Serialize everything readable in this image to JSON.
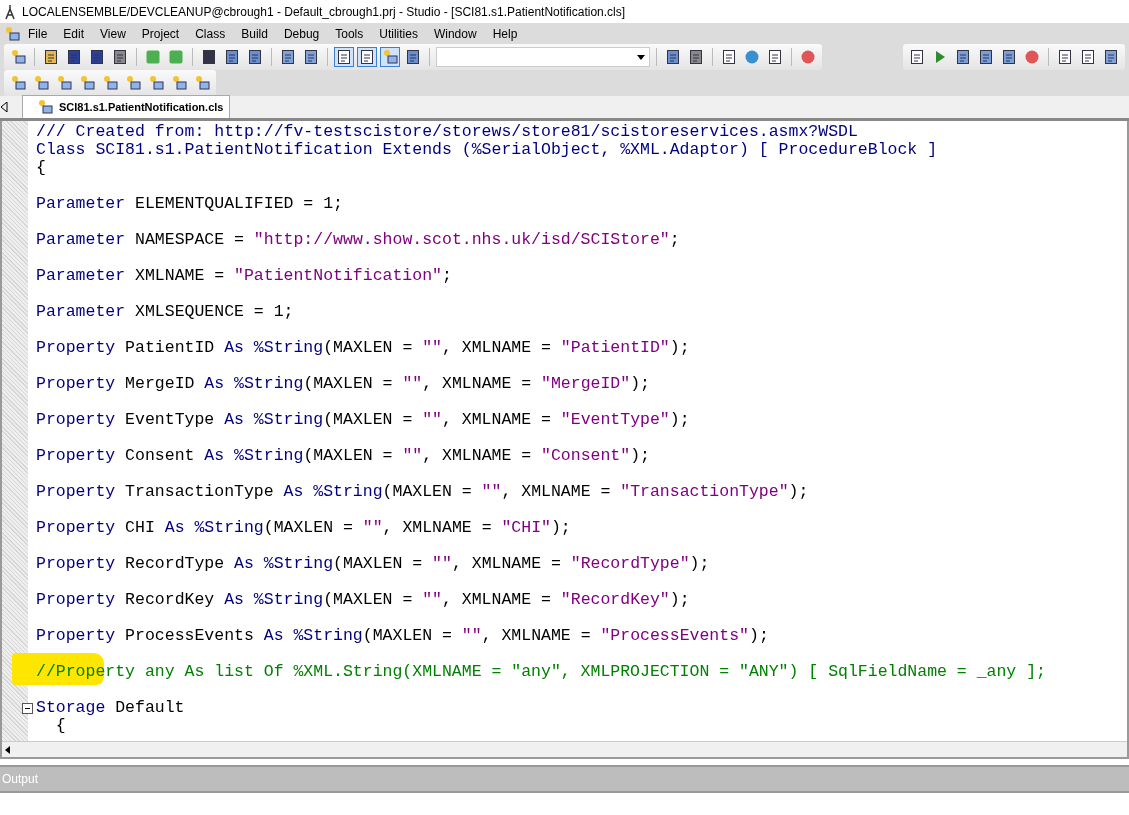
{
  "window": {
    "title": "LOCALENSEMBLE/DEVCLEANUP@cbrough1 - Default_cbrough1.prj - Studio - [SCI81.s1.PatientNotification.cls]"
  },
  "menu": [
    {
      "label": "File"
    },
    {
      "label": "Edit"
    },
    {
      "label": "View"
    },
    {
      "label": "Project"
    },
    {
      "label": "Class"
    },
    {
      "label": "Build"
    },
    {
      "label": "Debug"
    },
    {
      "label": "Tools"
    },
    {
      "label": "Utilities"
    },
    {
      "label": "Window"
    },
    {
      "label": "Help"
    }
  ],
  "tabs": [
    {
      "label": "SCI81.s1.PatientNotification.cls",
      "selected": true
    }
  ],
  "editor": {
    "lines": [
      {
        "kind": "code",
        "highlighted": false,
        "tokens": [
          {
            "kind": "doc",
            "text": "/// Created from: http://fv-testscistore/storews/store81/scistoreservices.asmx?WSDL"
          }
        ]
      },
      {
        "kind": "code",
        "highlighted": false,
        "tokens": [
          {
            "kind": "kw",
            "text": "Class SCI81.s1.PatientNotification Extends (%SerialObject, %XML.Adaptor) [ ProcedureBlock ]"
          }
        ]
      },
      {
        "kind": "code",
        "highlighted": false,
        "tokens": [
          {
            "kind": "plain",
            "text": "{"
          }
        ]
      },
      {
        "kind": "blank"
      },
      {
        "kind": "code",
        "highlighted": false,
        "tokens": [
          {
            "kind": "kw",
            "text": "Parameter"
          },
          {
            "kind": "plain",
            "text": " ELEMENTQUALIFIED = 1;"
          }
        ]
      },
      {
        "kind": "blank"
      },
      {
        "kind": "code",
        "highlighted": false,
        "tokens": [
          {
            "kind": "kw",
            "text": "Parameter"
          },
          {
            "kind": "plain",
            "text": " NAMESPACE = "
          },
          {
            "kind": "str",
            "text": "\"http://www.show.scot.nhs.uk/isd/SCIStore\""
          },
          {
            "kind": "plain",
            "text": ";"
          }
        ]
      },
      {
        "kind": "blank"
      },
      {
        "kind": "code",
        "highlighted": false,
        "tokens": [
          {
            "kind": "kw",
            "text": "Parameter"
          },
          {
            "kind": "plain",
            "text": " XMLNAME = "
          },
          {
            "kind": "str",
            "text": "\"PatientNotification\""
          },
          {
            "kind": "plain",
            "text": ";"
          }
        ]
      },
      {
        "kind": "blank"
      },
      {
        "kind": "code",
        "highlighted": false,
        "tokens": [
          {
            "kind": "kw",
            "text": "Parameter"
          },
          {
            "kind": "plain",
            "text": " XMLSEQUENCE = 1;"
          }
        ]
      },
      {
        "kind": "blank"
      },
      {
        "kind": "code",
        "highlighted": false,
        "tokens": [
          {
            "kind": "kw",
            "text": "Property"
          },
          {
            "kind": "plain",
            "text": " PatientID "
          },
          {
            "kind": "kw",
            "text": "As %String"
          },
          {
            "kind": "plain",
            "text": "(MAXLEN = "
          },
          {
            "kind": "str",
            "text": "\"\""
          },
          {
            "kind": "plain",
            "text": ", XMLNAME = "
          },
          {
            "kind": "str",
            "text": "\"PatientID\""
          },
          {
            "kind": "plain",
            "text": ");"
          }
        ]
      },
      {
        "kind": "blank"
      },
      {
        "kind": "code",
        "highlighted": false,
        "tokens": [
          {
            "kind": "kw",
            "text": "Property"
          },
          {
            "kind": "plain",
            "text": " MergeID "
          },
          {
            "kind": "kw",
            "text": "As %String"
          },
          {
            "kind": "plain",
            "text": "(MAXLEN = "
          },
          {
            "kind": "str",
            "text": "\"\""
          },
          {
            "kind": "plain",
            "text": ", XMLNAME = "
          },
          {
            "kind": "str",
            "text": "\"MergeID\""
          },
          {
            "kind": "plain",
            "text": ");"
          }
        ]
      },
      {
        "kind": "blank"
      },
      {
        "kind": "code",
        "highlighted": false,
        "tokens": [
          {
            "kind": "kw",
            "text": "Property"
          },
          {
            "kind": "plain",
            "text": " EventType "
          },
          {
            "kind": "kw",
            "text": "As %String"
          },
          {
            "kind": "plain",
            "text": "(MAXLEN = "
          },
          {
            "kind": "str",
            "text": "\"\""
          },
          {
            "kind": "plain",
            "text": ", XMLNAME = "
          },
          {
            "kind": "str",
            "text": "\"EventType\""
          },
          {
            "kind": "plain",
            "text": ");"
          }
        ]
      },
      {
        "kind": "blank"
      },
      {
        "kind": "code",
        "highlighted": false,
        "tokens": [
          {
            "kind": "kw",
            "text": "Property"
          },
          {
            "kind": "plain",
            "text": " Consent "
          },
          {
            "kind": "kw",
            "text": "As %String"
          },
          {
            "kind": "plain",
            "text": "(MAXLEN = "
          },
          {
            "kind": "str",
            "text": "\"\""
          },
          {
            "kind": "plain",
            "text": ", XMLNAME = "
          },
          {
            "kind": "str",
            "text": "\"Consent\""
          },
          {
            "kind": "plain",
            "text": ");"
          }
        ]
      },
      {
        "kind": "blank"
      },
      {
        "kind": "code",
        "highlighted": false,
        "tokens": [
          {
            "kind": "kw",
            "text": "Property"
          },
          {
            "kind": "plain",
            "text": " TransactionType "
          },
          {
            "kind": "kw",
            "text": "As %String"
          },
          {
            "kind": "plain",
            "text": "(MAXLEN = "
          },
          {
            "kind": "str",
            "text": "\"\""
          },
          {
            "kind": "plain",
            "text": ", XMLNAME = "
          },
          {
            "kind": "str",
            "text": "\"TransactionType\""
          },
          {
            "kind": "plain",
            "text": ");"
          }
        ]
      },
      {
        "kind": "blank"
      },
      {
        "kind": "code",
        "highlighted": false,
        "tokens": [
          {
            "kind": "kw",
            "text": "Property"
          },
          {
            "kind": "plain",
            "text": " CHI "
          },
          {
            "kind": "kw",
            "text": "As %String"
          },
          {
            "kind": "plain",
            "text": "(MAXLEN = "
          },
          {
            "kind": "str",
            "text": "\"\""
          },
          {
            "kind": "plain",
            "text": ", XMLNAME = "
          },
          {
            "kind": "str",
            "text": "\"CHI\""
          },
          {
            "kind": "plain",
            "text": ");"
          }
        ]
      },
      {
        "kind": "blank"
      },
      {
        "kind": "code",
        "highlighted": false,
        "tokens": [
          {
            "kind": "kw",
            "text": "Property"
          },
          {
            "kind": "plain",
            "text": " RecordType "
          },
          {
            "kind": "kw",
            "text": "As %String"
          },
          {
            "kind": "plain",
            "text": "(MAXLEN = "
          },
          {
            "kind": "str",
            "text": "\"\""
          },
          {
            "kind": "plain",
            "text": ", XMLNAME = "
          },
          {
            "kind": "str",
            "text": "\"RecordType\""
          },
          {
            "kind": "plain",
            "text": ");"
          }
        ]
      },
      {
        "kind": "blank"
      },
      {
        "kind": "code",
        "highlighted": false,
        "tokens": [
          {
            "kind": "kw",
            "text": "Property"
          },
          {
            "kind": "plain",
            "text": " RecordKey "
          },
          {
            "kind": "kw",
            "text": "As %String"
          },
          {
            "kind": "plain",
            "text": "(MAXLEN = "
          },
          {
            "kind": "str",
            "text": "\"\""
          },
          {
            "kind": "plain",
            "text": ", XMLNAME = "
          },
          {
            "kind": "str",
            "text": "\"RecordKey\""
          },
          {
            "kind": "plain",
            "text": ");"
          }
        ]
      },
      {
        "kind": "blank"
      },
      {
        "kind": "code",
        "highlighted": false,
        "tokens": [
          {
            "kind": "kw",
            "text": "Property"
          },
          {
            "kind": "plain",
            "text": " ProcessEvents "
          },
          {
            "kind": "kw",
            "text": "As %String"
          },
          {
            "kind": "plain",
            "text": "(MAXLEN = "
          },
          {
            "kind": "str",
            "text": "\"\""
          },
          {
            "kind": "plain",
            "text": ", XMLNAME = "
          },
          {
            "kind": "str",
            "text": "\"ProcessEvents\""
          },
          {
            "kind": "plain",
            "text": ");"
          }
        ]
      },
      {
        "kind": "blank"
      },
      {
        "kind": "code",
        "highlighted": true,
        "tokens": [
          {
            "kind": "comment",
            "text": "//Property any As list Of %XML.String(XMLNAME = \"any\", XMLPROJECTION = \"ANY\") [ SqlFieldName = _any ];"
          }
        ]
      },
      {
        "kind": "blank"
      },
      {
        "kind": "fold",
        "highlighted": false,
        "tokens": [
          {
            "kind": "kw",
            "text": "Storage"
          },
          {
            "kind": "plain",
            "text": " Default"
          }
        ]
      },
      {
        "kind": "code",
        "highlighted": false,
        "tokens": [
          {
            "kind": "plain",
            "text": "  {"
          }
        ]
      }
    ]
  },
  "output": {
    "title": "Output"
  }
}
